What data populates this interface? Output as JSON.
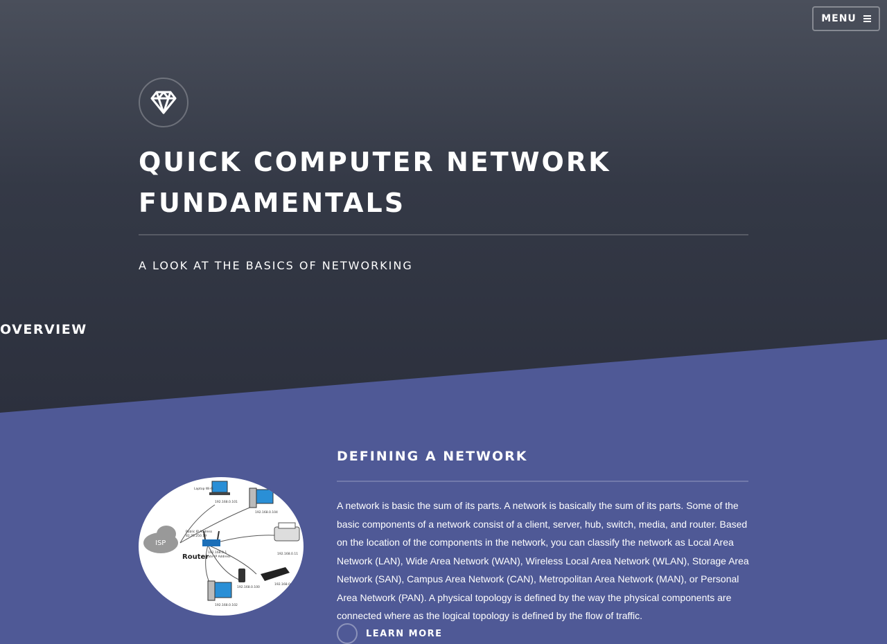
{
  "nav": {
    "menu_label": "MENU",
    "menu_icon": "hamburger-icon"
  },
  "banner": {
    "logo_icon": "diamond-icon",
    "title_line1": "QUICK COMPUTER NETWORK",
    "title_line2": "FUNDAMENTALS",
    "subtitle": "A LOOK AT THE BASICS OF NETWORKING",
    "overview_link": "OVERVIEW"
  },
  "section": {
    "title": "DEFINING A NETWORK",
    "body": "A network is basic the sum of its parts. A network is basically the sum of its parts. Some of the basic components of a network consist of a client, server, hub, switch, media, and router. Based on the location of the components in the network, you can classify the network as Local Area Network (LAN), Wide Area Network (WAN), Wireless Local Area Network (WLAN), Storage Area Network (SAN), Campus Area Network (CAN), Metropolitan Area Network (MAN), or Personal Area Network (PAN). A physical topology is defined by the way the physical components are connected where as the logical topology is defined by the flow of traffic.",
    "learn_more": "LEARN MORE",
    "diagram": {
      "cloud": "ISP",
      "router": "Router",
      "labels": [
        "192.168.0.101",
        "192.168.0.104",
        "192.168.0.1",
        "192.168.0.11",
        "192.168.0.100",
        "192.168.0.102",
        "192.168.0",
        "82.70.250.19",
        "Public IP Address",
        "Private IP Address",
        "Laptop Wi-Fi"
      ]
    }
  },
  "colors": {
    "header_top": "#4a4f5b",
    "header_bottom": "#2c303d",
    "section_bg": "#4f5996"
  }
}
